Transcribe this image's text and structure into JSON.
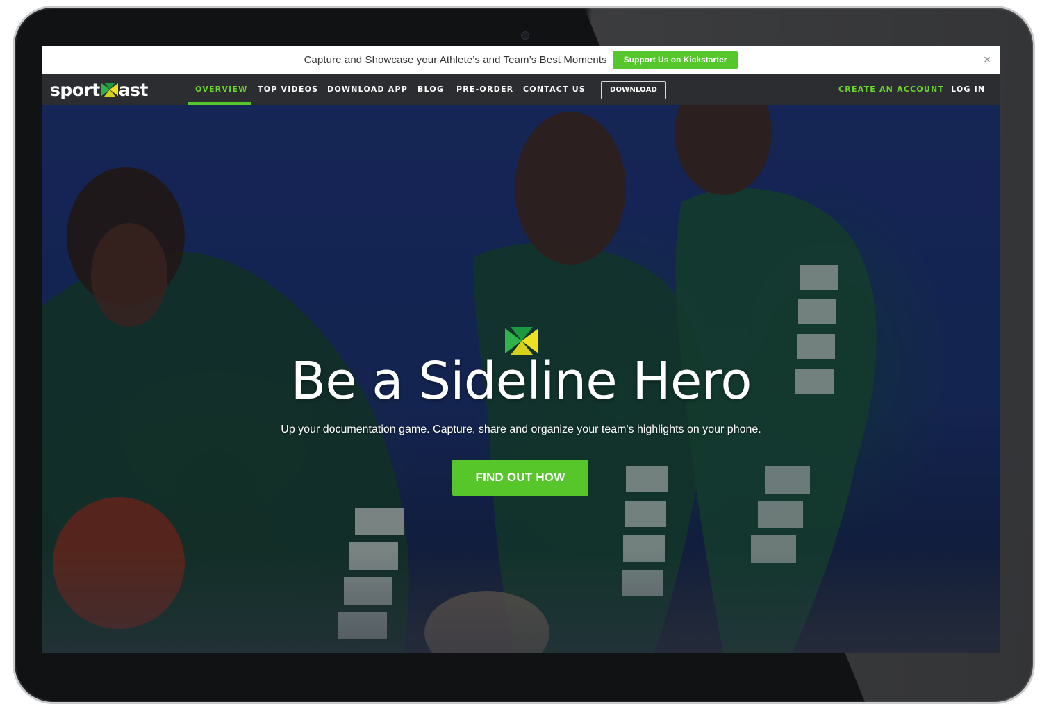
{
  "promo": {
    "text": "Capture and Showcase your Athlete’s and Team’s Best Moments",
    "button_label": "Support Us on Kickstarter",
    "close_glyph": "×"
  },
  "logo": {
    "text_left": "sport",
    "text_right": "ast",
    "icon": "sportcast-logo-icon"
  },
  "nav": {
    "items": [
      {
        "label": "OVERVIEW",
        "active": true
      },
      {
        "label": "TOP VIDEOS"
      },
      {
        "label": "DOWNLOAD APP"
      },
      {
        "label": "BLOG"
      },
      {
        "label": "PRE-ORDER"
      },
      {
        "label": "CONTACT US"
      }
    ],
    "download_label": "DOWNLOAD",
    "create_account_label": "CREATE AN ACCOUNT",
    "login_label": "LOG IN"
  },
  "hero": {
    "title": "Be a Sideline Hero",
    "subtitle": "Up your documentation game. Capture, share and organize your team's highlights on your phone.",
    "cta_label": "FIND OUT HOW"
  },
  "colors": {
    "accent": "#55c62b",
    "nav_bg": "#2b2d30",
    "hero_bg": "#1b2e6a"
  }
}
